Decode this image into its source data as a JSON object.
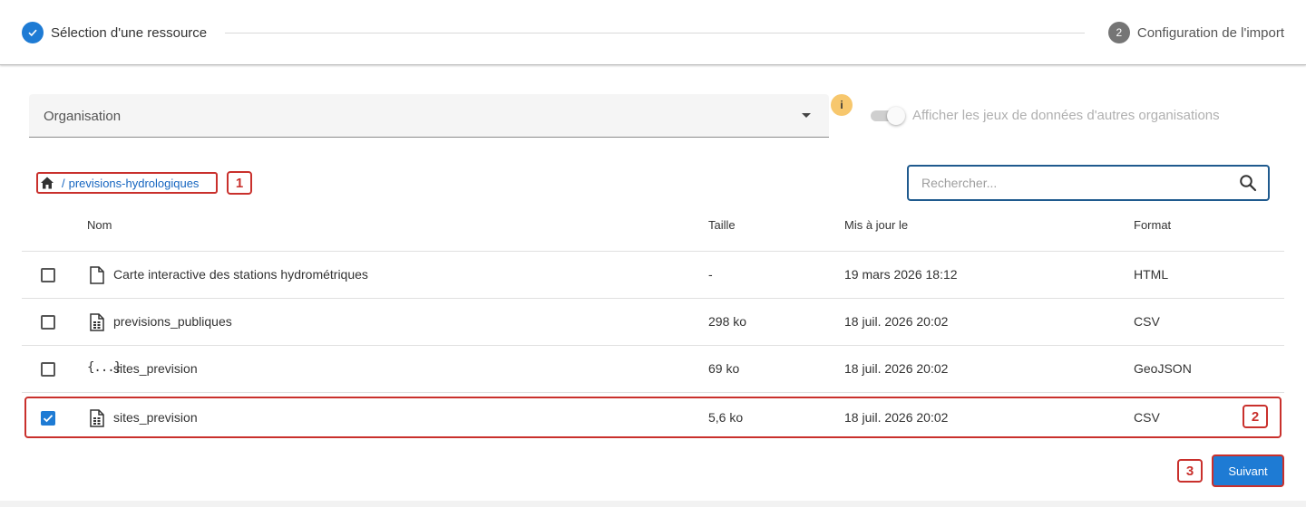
{
  "stepper": {
    "step1": {
      "label": "Sélection d'une ressource",
      "state": "done"
    },
    "step2": {
      "number": "2",
      "label": "Configuration de l'import",
      "state": "pending"
    }
  },
  "filters": {
    "organisation_label": "Organisation",
    "info_badge": "i",
    "toggle_label": "Afficher les jeux de données d'autres organisations",
    "toggle_on": false
  },
  "breadcrumb": {
    "separator": "/",
    "path": "previsions-hydrologiques"
  },
  "search": {
    "placeholder": "Rechercher..."
  },
  "table": {
    "headers": {
      "name": "Nom",
      "size": "Taille",
      "date": "Mis à jour le",
      "format": "Format"
    },
    "rows": [
      {
        "name": "Carte interactive des stations hydrométriques",
        "size": "-",
        "date": "19 mars 2026 18:12",
        "format": "HTML",
        "icon": "file-icon",
        "checked": false
      },
      {
        "name": "previsions_publiques",
        "size": "298 ko",
        "date": "18 juil. 2026 20:02",
        "format": "CSV",
        "icon": "spreadsheet-file-icon",
        "checked": false
      },
      {
        "name": "sites_prevision",
        "size": "69 ko",
        "date": "18 juil. 2026 20:02",
        "format": "GeoJSON",
        "icon": "json-icon",
        "json_glyph": "{...}",
        "checked": false
      },
      {
        "name": "sites_prevision",
        "size": "5,6 ko",
        "date": "18 juil. 2026 20:02",
        "format": "CSV",
        "icon": "spreadsheet-file-icon",
        "checked": true
      }
    ]
  },
  "annotations": [
    "1",
    "2",
    "3"
  ],
  "actions": {
    "next_label": "Suivant"
  },
  "colors": {
    "accent": "#1e7bd4",
    "annotation": "#c9302c",
    "info_badge": "#f7c76d"
  }
}
